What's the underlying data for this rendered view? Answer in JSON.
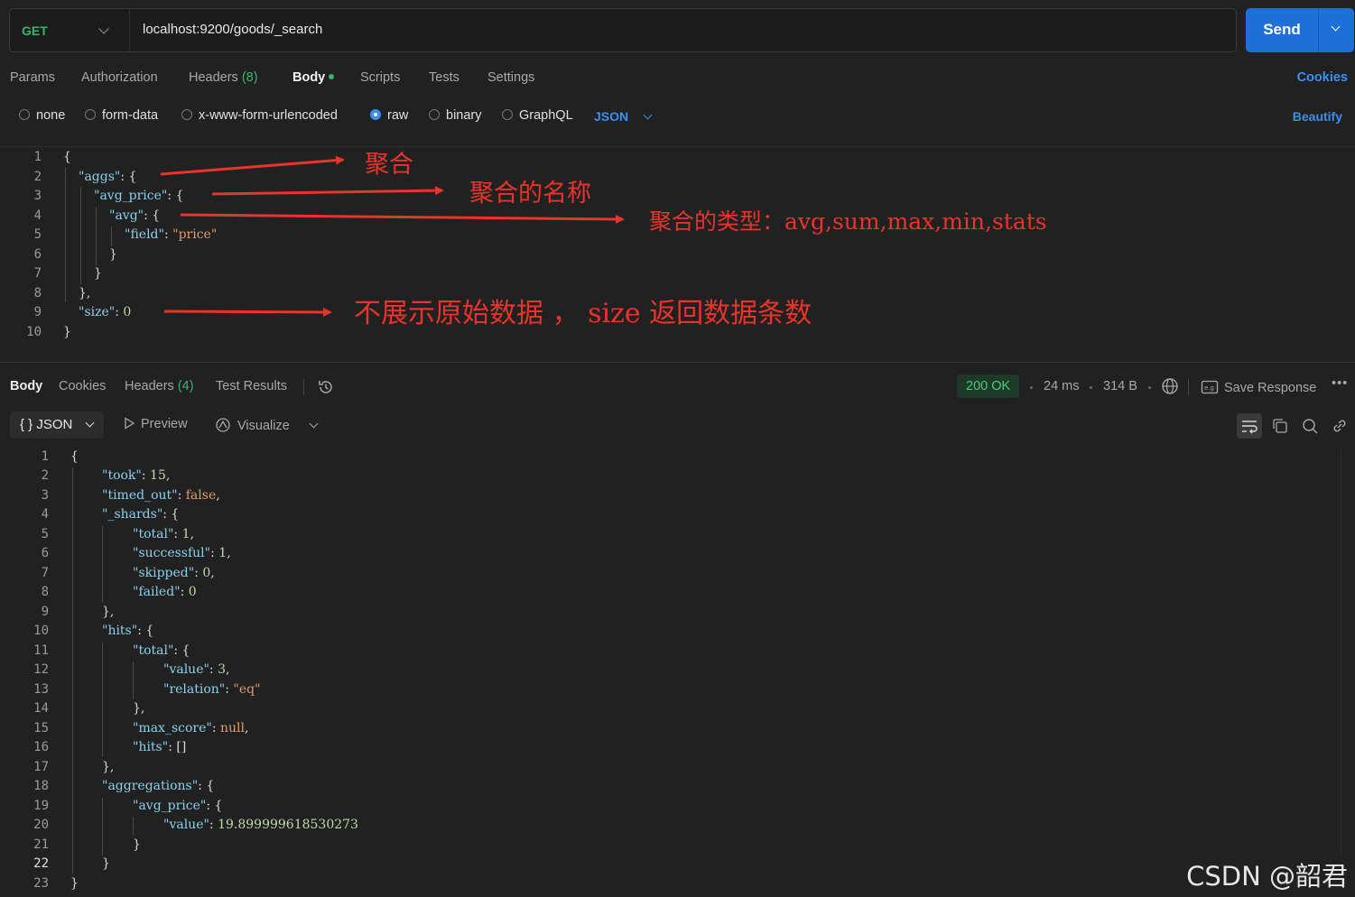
{
  "request": {
    "method": "GET",
    "url": "localhost:9200/goods/_search",
    "send_label": "Send"
  },
  "request_tabs": [
    {
      "label": "Params"
    },
    {
      "label": "Authorization"
    },
    {
      "label": "Headers",
      "count": "(8)"
    },
    {
      "label": "Body",
      "active": true
    },
    {
      "label": "Scripts"
    },
    {
      "label": "Tests"
    },
    {
      "label": "Settings"
    }
  ],
  "cookies_label": "Cookies",
  "body_types": [
    {
      "label": "none",
      "selected": false
    },
    {
      "label": "form-data",
      "selected": false
    },
    {
      "label": "x-www-form-urlencoded",
      "selected": false
    },
    {
      "label": "raw",
      "selected": true
    },
    {
      "label": "binary",
      "selected": false
    },
    {
      "label": "GraphQL",
      "selected": false
    }
  ],
  "body_format": "JSON",
  "beautify_label": "Beautify",
  "request_body": {
    "line_numbers": [
      "1",
      "2",
      "3",
      "4",
      "5",
      "6",
      "7",
      "8",
      "9",
      "10"
    ],
    "aggs_key": "\"aggs\"",
    "avg_price_key": "\"avg_price\"",
    "avg_key": "\"avg\"",
    "field_key": "\"field\"",
    "field_value": "\"price\"",
    "size_key": "\"size\"",
    "size_value": "0"
  },
  "annotations": {
    "aggs": "聚合",
    "avg_price": "聚合的名称",
    "avg": "聚合的类型：avg,sum,max,min,stats",
    "size": "不展示原始数据 ， size 返回数据条数"
  },
  "response_tabs": [
    {
      "label": "Body",
      "active": true
    },
    {
      "label": "Cookies"
    },
    {
      "label": "Headers",
      "count": "(4)"
    },
    {
      "label": "Test Results"
    }
  ],
  "response_status": "200 OK",
  "response_time": "24 ms",
  "response_size": "314 B",
  "save_response_label": "Save Response",
  "response_format": "JSON",
  "preview_label": "Preview",
  "visualize_label": "Visualize",
  "response_body": {
    "line_numbers": [
      "1",
      "2",
      "3",
      "4",
      "5",
      "6",
      "7",
      "8",
      "9",
      "10",
      "11",
      "12",
      "13",
      "14",
      "15",
      "16",
      "17",
      "18",
      "19",
      "20",
      "21",
      "22",
      "23"
    ],
    "took_key": "\"took\"",
    "took_value": "15",
    "timed_out_key": "\"timed_out\"",
    "timed_out_value": "false",
    "shards_key": "\"_shards\"",
    "total_key": "\"total\"",
    "total_value": "1",
    "successful_key": "\"successful\"",
    "successful_value": "1",
    "skipped_key": "\"skipped\"",
    "skipped_value": "0",
    "failed_key": "\"failed\"",
    "failed_value": "0",
    "hits_key": "\"hits\"",
    "hits_total_key": "\"total\"",
    "value_key": "\"value\"",
    "value_value": "3",
    "relation_key": "\"relation\"",
    "relation_value": "\"eq\"",
    "max_score_key": "\"max_score\"",
    "max_score_value": "null",
    "hits_inner_key": "\"hits\"",
    "hits_inner_value": "[]",
    "aggregations_key": "\"aggregations\"",
    "avg_price_key": "\"avg_price\"",
    "agg_value_key": "\"value\"",
    "agg_value_value": "19.899999618530273"
  },
  "watermark": "CSDN @韶君",
  "colors": {
    "accent": "#1f6fd8",
    "method_get": "#31b66d",
    "annotation_red": "#e8342b",
    "status_ok": "#3ed07a"
  }
}
